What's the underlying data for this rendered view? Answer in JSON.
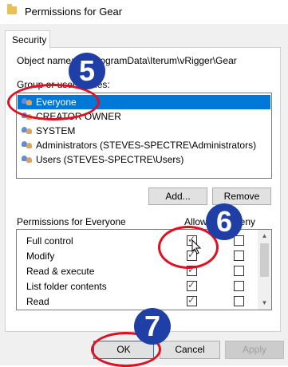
{
  "window": {
    "title": "Permissions for Gear"
  },
  "tabs": [
    {
      "label": "Security"
    }
  ],
  "object_name": {
    "label": "Object name:",
    "value": "C:\\ProgramData\\Iterum\\vRigger\\Gear"
  },
  "group_list": {
    "label": "Group or user names:",
    "items": [
      {
        "label": "Everyone",
        "icon": "group-icon",
        "selected": true
      },
      {
        "label": "CREATOR OWNER",
        "icon": "group-icon",
        "selected": false
      },
      {
        "label": "SYSTEM",
        "icon": "group-icon",
        "selected": false
      },
      {
        "label": "Administrators (STEVES-SPECTRE\\Administrators)",
        "icon": "group-icon",
        "selected": false
      },
      {
        "label": "Users (STEVES-SPECTRE\\Users)",
        "icon": "group-icon",
        "selected": false
      }
    ]
  },
  "buttons": {
    "add": "Add...",
    "remove": "Remove",
    "ok": "OK",
    "cancel": "Cancel",
    "apply": "Apply"
  },
  "permissions": {
    "label": "Permissions for Everyone",
    "allow_header": "Allow",
    "deny_header": "Deny",
    "rows": [
      {
        "name": "Full control",
        "allow": true,
        "deny": false
      },
      {
        "name": "Modify",
        "allow": true,
        "deny": false
      },
      {
        "name": "Read & execute",
        "allow": true,
        "deny": false
      },
      {
        "name": "List folder contents",
        "allow": true,
        "deny": false
      },
      {
        "name": "Read",
        "allow": true,
        "deny": false
      }
    ]
  },
  "callouts": {
    "step5": "5",
    "step6": "6",
    "step7": "7"
  },
  "colors": {
    "selection": "#0078d7",
    "badge": "#1f3fa6",
    "ring": "#e01020"
  }
}
